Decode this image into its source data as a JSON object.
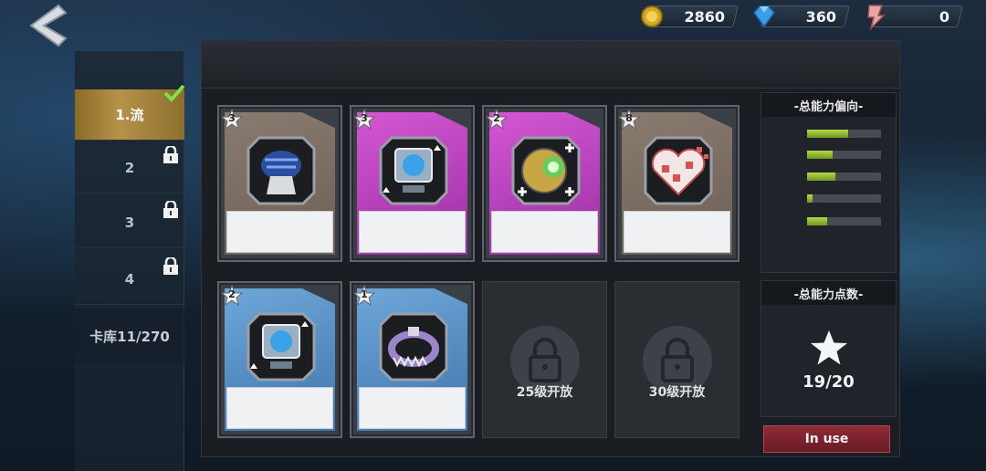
{
  "currencies": [
    {
      "icon": "gold-coin-icon",
      "value": "2860"
    },
    {
      "icon": "diamond-icon",
      "value": "360"
    },
    {
      "icon": "badge-icon",
      "value": "0"
    }
  ],
  "tabs": [
    {
      "label": "1.流",
      "active": true,
      "checked": true,
      "locked": false
    },
    {
      "label": "2",
      "active": false,
      "locked": true
    },
    {
      "label": "3",
      "active": false,
      "locked": true
    },
    {
      "label": "4",
      "active": false,
      "locked": true
    }
  ],
  "deck_label": "卡库11/270",
  "cards": [
    {
      "stars": "3",
      "color": "brown",
      "icon": "blue-glove-icon"
    },
    {
      "stars": "3",
      "color": "purple",
      "icon": "monitor-upgrade-icon"
    },
    {
      "stars": "2",
      "color": "purple",
      "icon": "orb-plus-icon"
    },
    {
      "stars": "8",
      "color": "brown",
      "icon": "pixel-heart-icon"
    },
    {
      "stars": "2",
      "color": "blue",
      "icon": "monitor-upgrade-icon"
    },
    {
      "stars": "1",
      "color": "blue",
      "icon": "spiked-collar-icon"
    }
  ],
  "locked_slots": [
    {
      "label": "25级开放"
    },
    {
      "label": "30级开放"
    }
  ],
  "ability_tendency": {
    "title": "-总能力偏向-",
    "bars": [
      0.55,
      0.35,
      0.38,
      0.08,
      0.27
    ]
  },
  "ability_points": {
    "title": "-总能力点数-",
    "value": "19/20"
  },
  "in_use_label": "In use"
}
